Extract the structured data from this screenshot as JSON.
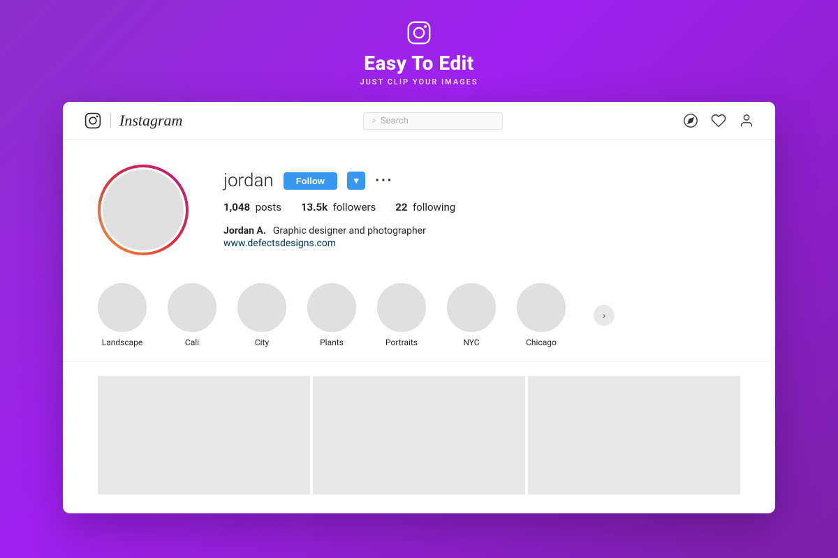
{
  "promo": {
    "title": "Easy To Edit",
    "subtitle": "JUST CLIP YOUR IMAGES"
  },
  "navbar": {
    "brand": "Instagram",
    "search_placeholder": "Search",
    "search_icon": "🔍"
  },
  "profile": {
    "username": "jordan",
    "follow_label": "Follow",
    "more_label": "···",
    "stats": {
      "posts_count": "1,048",
      "posts_label": "posts",
      "followers_count": "13.5k",
      "followers_label": "followers",
      "following_count": "22",
      "following_label": "following"
    },
    "bio": {
      "name": "Jordan A.",
      "description": "Graphic designer and photographer",
      "link": "www.defectsdesigns.com"
    }
  },
  "highlights": [
    {
      "label": "Landscape"
    },
    {
      "label": "Cali"
    },
    {
      "label": "City"
    },
    {
      "label": "Plants"
    },
    {
      "label": "Portraits"
    },
    {
      "label": "NYC"
    },
    {
      "label": "Chicago"
    }
  ],
  "grid": {
    "items": [
      "",
      "",
      ""
    ]
  }
}
